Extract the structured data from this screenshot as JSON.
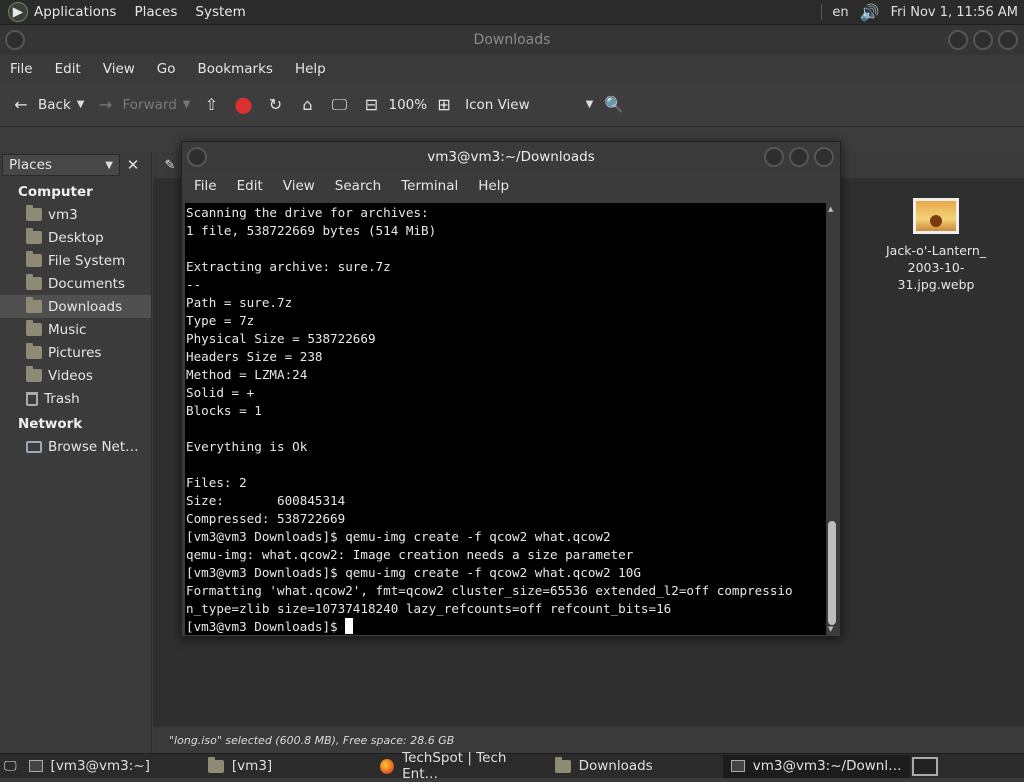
{
  "topbar": {
    "menus": [
      "Applications",
      "Places",
      "System"
    ],
    "lang": "en",
    "clock": "Fri Nov 1, 11:56 AM"
  },
  "filemanager": {
    "title": "Downloads",
    "menus": [
      "File",
      "Edit",
      "View",
      "Go",
      "Bookmarks",
      "Help"
    ],
    "toolbar": {
      "back": "Back",
      "forward": "Forward",
      "zoom": "100%",
      "view_mode": "Icon View"
    },
    "sidebar": {
      "selector": "Places",
      "groups": [
        {
          "label": "Computer",
          "items": [
            "vm3",
            "Desktop",
            "File System",
            "Documents",
            "Downloads",
            "Music",
            "Pictures",
            "Videos",
            "Trash"
          ]
        },
        {
          "label": "Network",
          "items": [
            "Browse Net…"
          ]
        }
      ],
      "active": "Downloads"
    },
    "file": {
      "name_line1": "Jack-o'-Lantern_",
      "name_line2": "2003-10-31.jpg.webp"
    },
    "status": "\"long.iso\" selected (600.8 MB), Free space: 28.6 GB"
  },
  "terminal": {
    "title": "vm3@vm3:~/Downloads",
    "menus": [
      "File",
      "Edit",
      "View",
      "Search",
      "Terminal",
      "Help"
    ],
    "lines": [
      "Scanning the drive for archives:",
      "1 file, 538722669 bytes (514 MiB)",
      "",
      "Extracting archive: sure.7z",
      "--",
      "Path = sure.7z",
      "Type = 7z",
      "Physical Size = 538722669",
      "Headers Size = 238",
      "Method = LZMA:24",
      "Solid = +",
      "Blocks = 1",
      "",
      "Everything is Ok",
      "",
      "Files: 2",
      "Size:       600845314",
      "Compressed: 538722669",
      "[vm3@vm3 Downloads]$ qemu-img create -f qcow2 what.qcow2",
      "qemu-img: what.qcow2: Image creation needs a size parameter",
      "[vm3@vm3 Downloads]$ qemu-img create -f qcow2 what.qcow2 10G",
      "Formatting 'what.qcow2', fmt=qcow2 cluster_size=65536 extended_l2=off compressio",
      "n_type=zlib size=10737418240 lazy_refcounts=off refcount_bits=16"
    ],
    "prompt": "[vm3@vm3 Downloads]$ "
  },
  "taskbar": {
    "tasks": [
      "[vm3@vm3:~]",
      "[vm3]",
      "TechSpot | Tech Ent…",
      "Downloads",
      "vm3@vm3:~/Downl…"
    ]
  }
}
